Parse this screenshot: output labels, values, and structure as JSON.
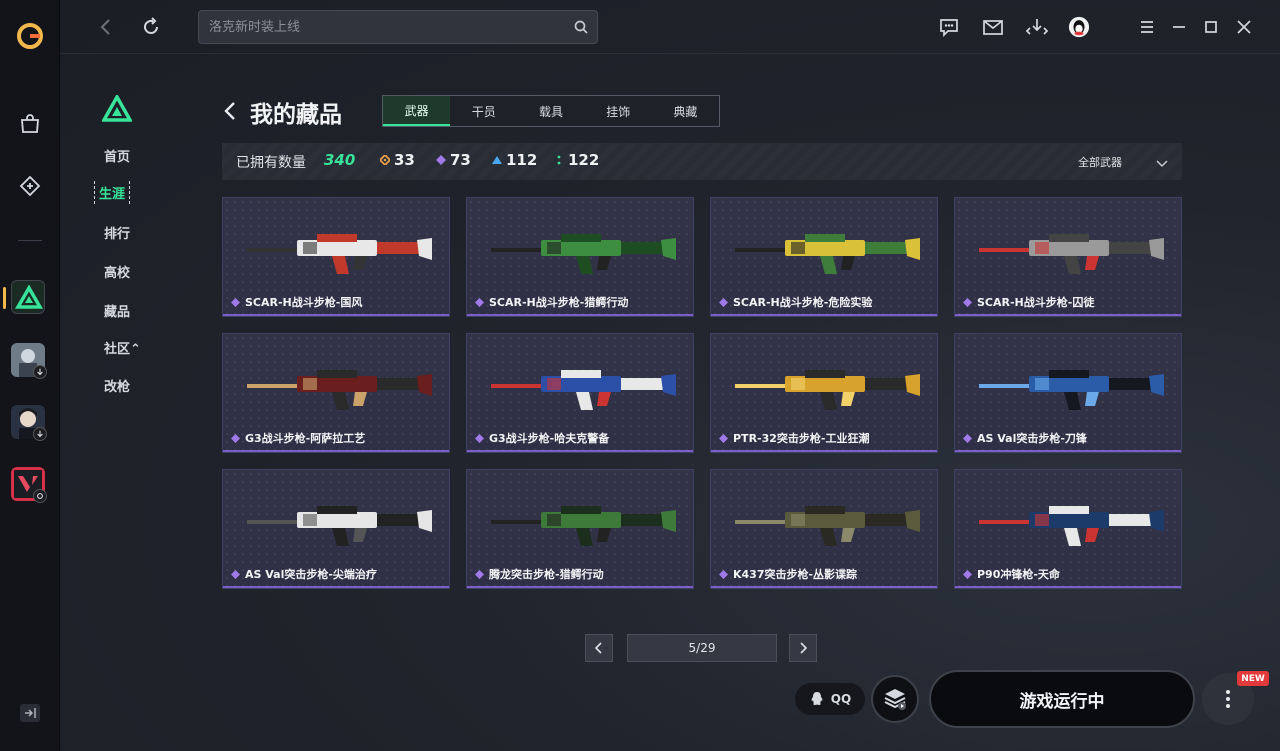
{
  "app": {
    "search": {
      "placeholder": "洛克新时装上线"
    }
  },
  "topbar_icons": [
    "chat-icon",
    "mail-icon",
    "download-icon",
    "avatar",
    "menu-icon",
    "minimize-icon",
    "maximize-icon",
    "close-icon"
  ],
  "rail": {
    "games": [
      "game-active-delta",
      "game-1",
      "game-2",
      "game-valorant"
    ]
  },
  "subnav": {
    "items": [
      {
        "label": "首页"
      },
      {
        "label": "生涯"
      },
      {
        "label": "排行"
      },
      {
        "label": "高校"
      },
      {
        "label": "藏品"
      },
      {
        "label": "社区⌃"
      },
      {
        "label": "改枪"
      }
    ],
    "active_index": 1
  },
  "page": {
    "title": "我的藏品",
    "tabs": [
      "武器",
      "干员",
      "载具",
      "挂饰",
      "典藏"
    ],
    "active_tab": 0
  },
  "stats": {
    "owned_label": "已拥有数量",
    "owned_value": "340",
    "counts": [
      {
        "value": "33",
        "color": "#f0a24a"
      },
      {
        "value": "73",
        "color": "#a07ae8"
      },
      {
        "value": "112",
        "color": "#4aa8f0"
      },
      {
        "value": "122",
        "color": "#38e39a"
      }
    ],
    "filter_label": "全部武器"
  },
  "items": [
    {
      "name": "SCAR-H战斗步枪-国风",
      "colors": [
        "#e8e8e8",
        "#c0392b",
        "#333"
      ]
    },
    {
      "name": "SCAR-H战斗步枪-猎鳄行动",
      "colors": [
        "#3e8e41",
        "#1f4d22",
        "#222"
      ]
    },
    {
      "name": "SCAR-H战斗步枪-危险实验",
      "colors": [
        "#d9c13a",
        "#3f7d3a",
        "#222"
      ]
    },
    {
      "name": "SCAR-H战斗步枪-囚徒",
      "colors": [
        "#9a9a9a",
        "#444",
        "#c33"
      ]
    },
    {
      "name": "G3战斗步枪-阿萨拉工艺",
      "colors": [
        "#6b1e1e",
        "#2a2a2a",
        "#caa26a"
      ]
    },
    {
      "name": "G3战斗步枪-哈夫克警备",
      "colors": [
        "#2c4fa8",
        "#e8e8e8",
        "#c33"
      ]
    },
    {
      "name": "PTR-32突击步枪-工业狂潮",
      "colors": [
        "#d7a32c",
        "#2a2a2a",
        "#f2d16b"
      ]
    },
    {
      "name": "AS Val突击步枪-刀锋",
      "colors": [
        "#2a5ca8",
        "#151820",
        "#6aa8e8"
      ]
    },
    {
      "name": "AS Val突击步枪-尖端治疗",
      "colors": [
        "#e6e6e6",
        "#222",
        "#555"
      ]
    },
    {
      "name": "腾龙突击步枪-猎鳄行动",
      "colors": [
        "#3e7a3a",
        "#1c2e1c",
        "#222"
      ]
    },
    {
      "name": "K437突击步枪-丛影谍踪",
      "colors": [
        "#5a5a3c",
        "#2a2a22",
        "#8a8a6a"
      ]
    },
    {
      "name": "P90冲锋枪-天命",
      "colors": [
        "#1c3a6a",
        "#e8e8e8",
        "#c33"
      ]
    }
  ],
  "pager": {
    "label": "5/29"
  },
  "actions": {
    "qq_label": "QQ",
    "run_label": "游戏运行中",
    "new_badge": "NEW"
  }
}
